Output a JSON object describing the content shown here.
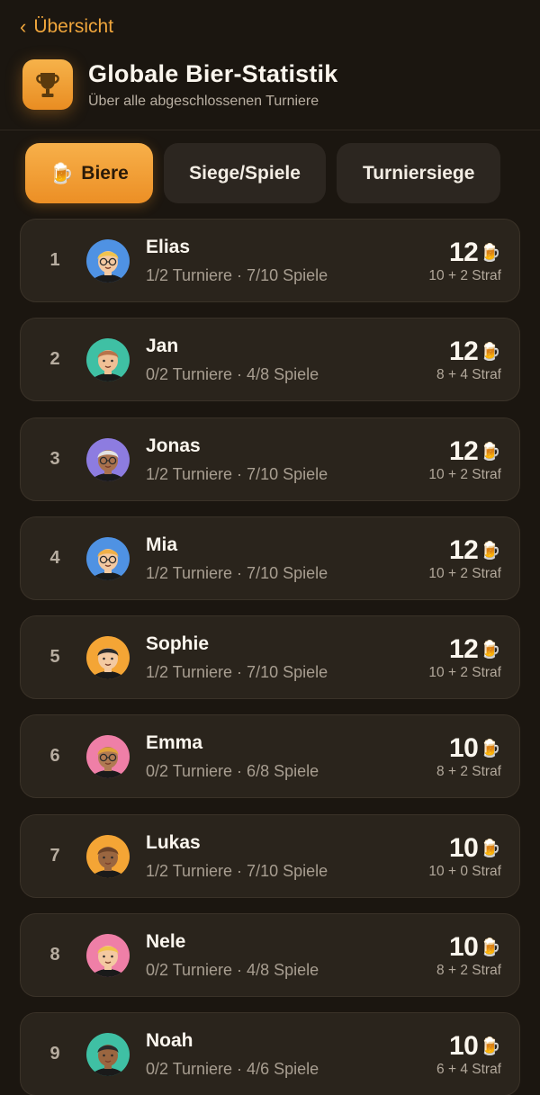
{
  "nav": {
    "back_label": "Übersicht"
  },
  "header": {
    "title": "Globale Bier-Statistik",
    "subtitle": "Über alle abgeschlossenen Turniere",
    "icon": "🏆"
  },
  "tabs": [
    {
      "label": "Biere",
      "icon": "🍺",
      "active": true
    },
    {
      "label": "Siege/Spiele",
      "active": false
    },
    {
      "label": "Turniersiege",
      "active": false
    }
  ],
  "players": [
    {
      "rank": "1",
      "name": "Elias",
      "stats": "1/2 Turniere · 7/10 Spiele",
      "beers": "12",
      "breakdown": "10 + 2 Straf",
      "avatar_bg": "#4f92e3",
      "skin": "#f3c9a1",
      "hair": "#f0c34d",
      "glasses": true
    },
    {
      "rank": "2",
      "name": "Jan",
      "stats": "0/2 Turniere · 4/8 Spiele",
      "beers": "12",
      "breakdown": "8 + 4 Straf",
      "avatar_bg": "#3fc0a4",
      "skin": "#f0bf95",
      "hair": "#b8734a",
      "glasses": false
    },
    {
      "rank": "3",
      "name": "Jonas",
      "stats": "1/2 Turniere · 7/10 Spiele",
      "beers": "12",
      "breakdown": "10 + 2 Straf",
      "avatar_bg": "#8d7ce0",
      "skin": "#a8714d",
      "hair": "#e2e2e2",
      "glasses": true
    },
    {
      "rank": "4",
      "name": "Mia",
      "stats": "1/2 Turniere · 7/10 Spiele",
      "beers": "12",
      "breakdown": "10 + 2 Straf",
      "avatar_bg": "#4f92e3",
      "skin": "#f3c9a1",
      "hair": "#f0b048",
      "glasses": true
    },
    {
      "rank": "5",
      "name": "Sophie",
      "stats": "1/2 Turniere · 7/10 Spiele",
      "beers": "12",
      "breakdown": "10 + 2 Straf",
      "avatar_bg": "#f4a535",
      "skin": "#f3c9a1",
      "hair": "#2b2b2b",
      "glasses": false
    },
    {
      "rank": "6",
      "name": "Emma",
      "stats": "0/2 Turniere · 6/8 Spiele",
      "beers": "10",
      "breakdown": "8 + 2 Straf",
      "avatar_bg": "#ef7fa7",
      "skin": "#b07a52",
      "hair": "#e0a13a",
      "glasses": true
    },
    {
      "rank": "7",
      "name": "Lukas",
      "stats": "1/2 Turniere · 7/10 Spiele",
      "beers": "10",
      "breakdown": "10 + 0 Straf",
      "avatar_bg": "#f4a535",
      "skin": "#9a6640",
      "hair": "#6e4428",
      "glasses": false
    },
    {
      "rank": "8",
      "name": "Nele",
      "stats": "0/2 Turniere · 4/8 Spiele",
      "beers": "10",
      "breakdown": "8 + 2 Straf",
      "avatar_bg": "#ef7fa7",
      "skin": "#f3c9a1",
      "hair": "#f0c34d",
      "glasses": false
    },
    {
      "rank": "9",
      "name": "Noah",
      "stats": "0/2 Turniere · 4/6 Spiele",
      "beers": "10",
      "breakdown": "6 + 4 Straf",
      "avatar_bg": "#3fc0a4",
      "skin": "#9a6640",
      "hair": "#2b2b2b",
      "glasses": false
    }
  ],
  "colors": {
    "accent": "#f0a63c",
    "background": "#1b1610",
    "card": "#2a241c"
  }
}
